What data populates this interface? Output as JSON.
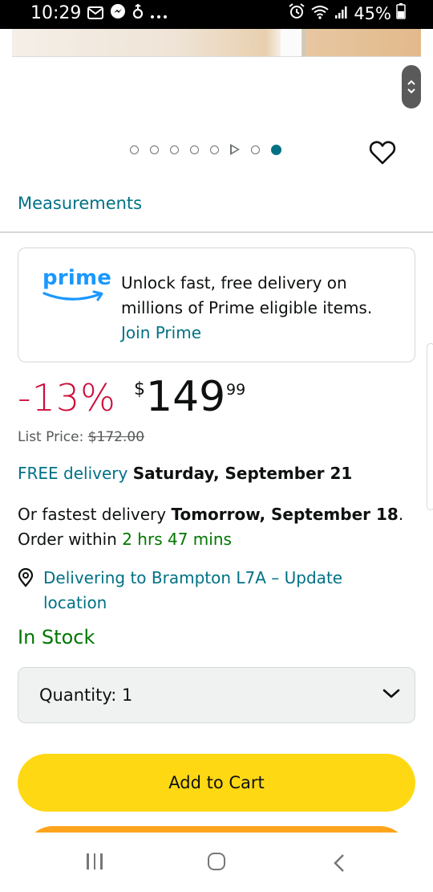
{
  "status_bar": {
    "time": "10:29",
    "battery": "45%"
  },
  "gallery": {
    "dot_count": 8,
    "active_dot_index": 7,
    "video_dot_index": 5
  },
  "measurements_link": "Measurements",
  "prime": {
    "logo_text": "prime",
    "message": "Unlock fast, free delivery on millions of Prime eligible items.",
    "join_label": "Join Prime"
  },
  "price": {
    "discount": "-13%",
    "currency": "$",
    "whole": "149",
    "fraction": "99",
    "list_label": "List Price:",
    "list_value": "$172.00"
  },
  "delivery": {
    "free_label": "FREE delivery",
    "date": "Saturday, September 21"
  },
  "fastest": {
    "prefix": "Or fastest delivery",
    "date": "Tomorrow, September 18",
    "suffix": ".",
    "order_within_label": "Order within",
    "countdown": "2 hrs 47 mins"
  },
  "location": {
    "text": "Delivering to Brampton L7A – Update location"
  },
  "stock_status": "In Stock",
  "quantity": {
    "label": "Quantity:",
    "value": "1"
  },
  "buttons": {
    "add_to_cart": "Add to Cart"
  },
  "colors": {
    "link": "#007185",
    "discount": "#cc0c39",
    "in_stock": "#007600",
    "add_to_cart": "#ffd814",
    "buy_now": "#ffa41c",
    "prime_blue": "#1a98ff"
  }
}
